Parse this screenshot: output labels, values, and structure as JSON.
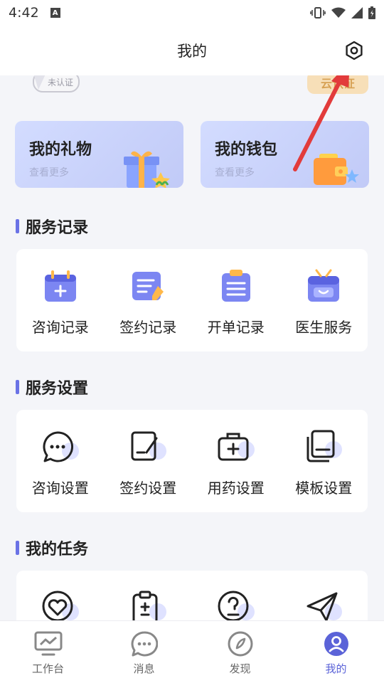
{
  "status_bar": {
    "time": "4:42"
  },
  "header": {
    "title": "我的"
  },
  "profile": {
    "unverified_label": "未认证",
    "cloud_badge_label": "云认证"
  },
  "cards": [
    {
      "title": "我的礼物",
      "subtitle": "查看更多",
      "icon": "gift-icon"
    },
    {
      "title": "我的钱包",
      "subtitle": "查看更多",
      "icon": "wallet-icon"
    }
  ],
  "sections": [
    {
      "title": "服务记录",
      "items": [
        {
          "label": "咨询记录",
          "icon": "calendar-add-icon"
        },
        {
          "label": "签约记录",
          "icon": "signed-document-icon"
        },
        {
          "label": "开单记录",
          "icon": "clipboard-icon"
        },
        {
          "label": "医生服务",
          "icon": "doctor-service-icon"
        }
      ]
    },
    {
      "title": "服务设置",
      "items": [
        {
          "label": "咨询设置",
          "icon": "chat-settings-icon"
        },
        {
          "label": "签约设置",
          "icon": "sign-settings-icon"
        },
        {
          "label": "用药设置",
          "icon": "medicine-kit-icon"
        },
        {
          "label": "模板设置",
          "icon": "template-icon"
        }
      ]
    },
    {
      "title": "我的任务",
      "items": [
        {
          "label": "",
          "icon": "heart-care-icon"
        },
        {
          "label": "",
          "icon": "clipboard-plus-minus-icon"
        },
        {
          "label": "",
          "icon": "question-icon"
        },
        {
          "label": "",
          "icon": "paper-plane-icon"
        }
      ]
    }
  ],
  "tabs": [
    {
      "label": "工作台",
      "icon": "dashboard-icon",
      "active": false
    },
    {
      "label": "消息",
      "icon": "message-icon",
      "active": false
    },
    {
      "label": "发现",
      "icon": "compass-icon",
      "active": false
    },
    {
      "label": "我的",
      "icon": "profile-icon",
      "active": true
    }
  ],
  "colors": {
    "accent": "#5b63d8",
    "section_bar": "#6a72e6",
    "annotation_arrow": "#e23b3b"
  }
}
